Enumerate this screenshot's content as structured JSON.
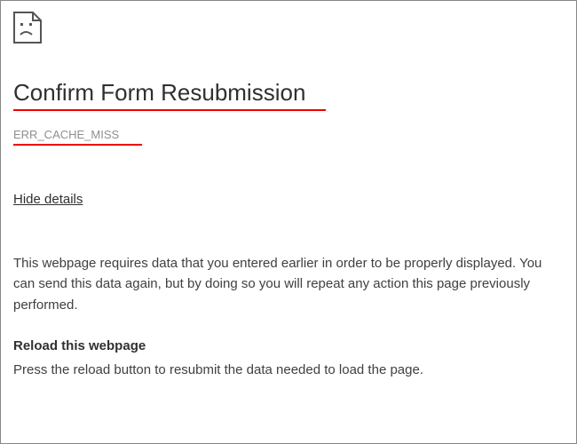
{
  "error": {
    "title": "Confirm Form Resubmission",
    "code": "ERR_CACHE_MISS",
    "toggle_label": "Hide details",
    "description": "This webpage requires data that you entered earlier in order to be properly displayed. You can send this data again, but by doing so you will repeat any action this page previously performed.",
    "section_heading": "Reload this webpage",
    "section_body": "Press the reload button to resubmit the data needed to load the page."
  }
}
